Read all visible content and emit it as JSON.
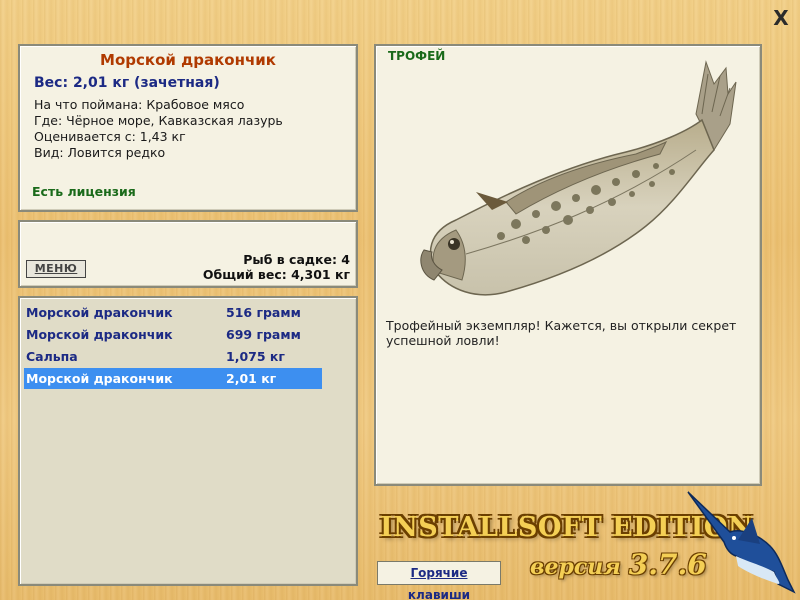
{
  "window": {
    "close_label": "X"
  },
  "info": {
    "fish_name": "Морской дракончик",
    "weight_line": "Вес: 2,01 кг (зачетная)",
    "details": [
      "На что поймана: Крабовое мясо",
      "Где: Чёрное море, Кавказская лазурь",
      "Оценивается с: 1,43 кг",
      "Вид: Ловится редко"
    ],
    "license": "Есть лицензия"
  },
  "cage": {
    "menu_label": "МЕНЮ",
    "fish_count": "Рыб в садке: 4",
    "total_weight": "Общий вес: 4,301 кг"
  },
  "catch_list": [
    {
      "name": "Морской дракончик",
      "weight": "516 грамм",
      "selected": false
    },
    {
      "name": "Морской дракончик",
      "weight": "699 грамм",
      "selected": false
    },
    {
      "name": "Сальпа",
      "weight": "1,075 кг",
      "selected": false
    },
    {
      "name": "Морской дракончик",
      "weight": "2,01 кг",
      "selected": true
    }
  ],
  "trophy": {
    "tag": "ТРОФЕЙ",
    "caption": "Трофейный экземпляр! Кажется, вы открыли секрет успешной ловли!",
    "image": "weever-fish"
  },
  "branding": {
    "edition": "INSTALLSOFT EDITION",
    "version_word": "версия",
    "version_number": "3.7.6",
    "emblem": "marlin"
  },
  "hotkeys_label": "Горячие клавиши",
  "colors": {
    "title": "#b03a00",
    "accent_blue": "#1c2a84",
    "license_green": "#1a6a1a",
    "selection": "#3d8ff0"
  }
}
